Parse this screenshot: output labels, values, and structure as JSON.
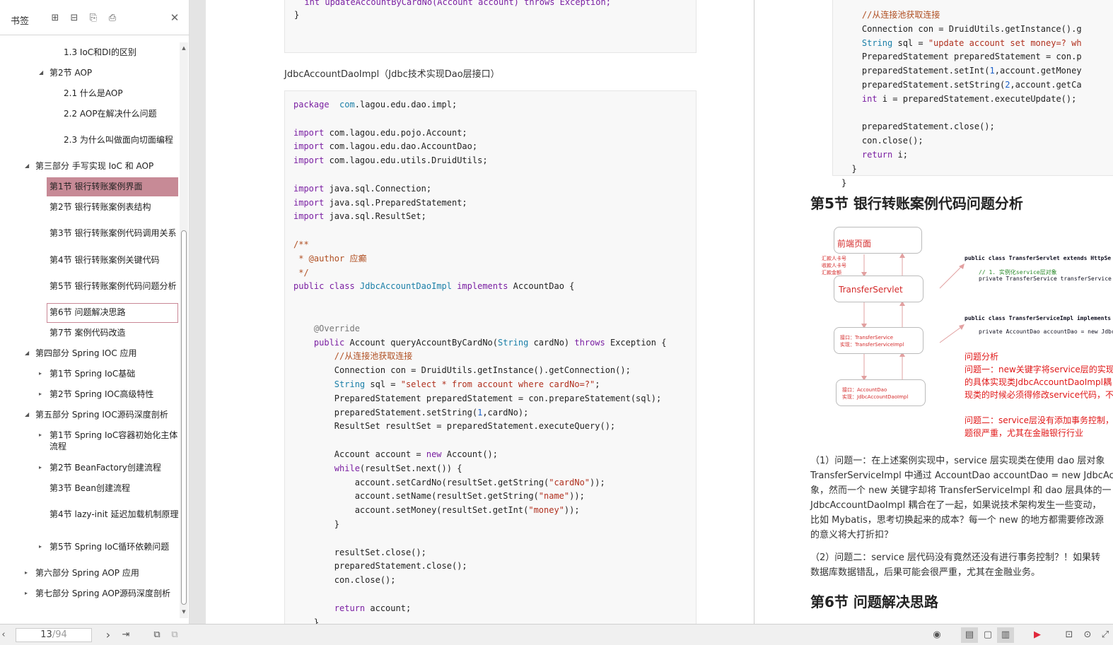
{
  "sidebar": {
    "title": "书签",
    "tools": [
      "expand-all-icon",
      "collapse-all-icon",
      "add-bookmark-icon",
      "bookmark-icon"
    ],
    "items": [
      {
        "label": "1.3 IoC和DI的区别",
        "level": 2
      },
      {
        "label": "第2节 AOP",
        "level": 1,
        "expanded": true
      },
      {
        "label": "2.1 什么是AOP",
        "level": 2
      },
      {
        "label": "2.2 AOP在解决什么问题",
        "level": 2
      },
      {
        "label": "2.3 为什么叫做面向切面编程",
        "level": 2
      },
      {
        "label": "第三部分 手写实现 IoC 和 AOP",
        "level": 0,
        "expanded": true
      },
      {
        "label": "第1节 银行转账案例界面",
        "level": 1,
        "active": true
      },
      {
        "label": "第2节 银行转账案例表结构",
        "level": 1
      },
      {
        "label": "第3节 银行转账案例代码调用关系",
        "level": 1
      },
      {
        "label": "第4节 银行转账案例关键代码",
        "level": 1
      },
      {
        "label": "第5节 银行转账案例代码问题分析",
        "level": 1
      },
      {
        "label": "第6节 问题解决思路",
        "level": 1,
        "outlined": true
      },
      {
        "label": "第7节 案例代码改造",
        "level": 1
      },
      {
        "label": "第四部分 Spring IOC 应用",
        "level": 0,
        "expanded": true
      },
      {
        "label": "第1节 Spring IoC基础",
        "level": 1,
        "collapsed": true
      },
      {
        "label": "第2节 Spring IOC高级特性",
        "level": 1,
        "collapsed": true
      },
      {
        "label": "第五部分 Spring IOC源码深度剖析",
        "level": 0,
        "expanded": true
      },
      {
        "label": "第1节 Spring IoC容器初始化主体流程",
        "level": 1,
        "collapsed": true
      },
      {
        "label": "第2节 BeanFactory创建流程",
        "level": 1,
        "collapsed": true
      },
      {
        "label": "第3节 Bean创建流程",
        "level": 1
      },
      {
        "label": "第4节 lazy-init 延迟加载机制原理",
        "level": 1
      },
      {
        "label": "第5节 Spring IoC循环依赖问题",
        "level": 1,
        "collapsed": true
      },
      {
        "label": "第六部分 Spring AOP 应用",
        "level": 0,
        "collapsed": true
      },
      {
        "label": "第七部分 Spring AOP源码深度剖析",
        "level": 0,
        "collapsed": true
      }
    ]
  },
  "page1": {
    "top_code": [
      "int updateAccountByCardNo(Account account) throws Exception;",
      "}"
    ],
    "caption": "JdbcAccountDaoImpl（Jdbc技术实现Dao层接口）",
    "code": [
      [
        [
          "kw",
          "package"
        ],
        [
          "",
          "  "
        ],
        [
          "tp",
          "com"
        ],
        [
          "",
          ".lagou.edu.dao.impl;"
        ]
      ],
      [],
      [
        [
          "kw",
          "import"
        ],
        [
          "",
          " com.lagou.edu.pojo.Account;"
        ]
      ],
      [
        [
          "kw",
          "import"
        ],
        [
          "",
          " com.lagou.edu.dao.AccountDao;"
        ]
      ],
      [
        [
          "kw",
          "import"
        ],
        [
          "",
          " com.lagou.edu.utils.DruidUtils;"
        ]
      ],
      [],
      [
        [
          "kw",
          "import"
        ],
        [
          "",
          " java.sql.Connection;"
        ]
      ],
      [
        [
          "kw",
          "import"
        ],
        [
          "",
          " java.sql.PreparedStatement;"
        ]
      ],
      [
        [
          "kw",
          "import"
        ],
        [
          "",
          " java.sql.ResultSet;"
        ]
      ],
      [],
      [
        [
          "cm",
          "/**"
        ]
      ],
      [
        [
          "cm",
          " * @author 应癫"
        ]
      ],
      [
        [
          "cm",
          " */"
        ]
      ],
      [
        [
          "kw",
          "public class "
        ],
        [
          "tp",
          "JdbcAccountDaoImpl"
        ],
        [
          "kw",
          " implements"
        ],
        [
          "",
          " AccountDao {"
        ]
      ],
      [],
      [],
      [
        [
          "an",
          "    @Override"
        ]
      ],
      [
        [
          "kw",
          "    public"
        ],
        [
          "",
          " Account queryAccountByCardNo("
        ],
        [
          "tp",
          "String"
        ],
        [
          "",
          " cardNo) "
        ],
        [
          "kw",
          "throws"
        ],
        [
          "",
          " Exception {"
        ]
      ],
      [
        [
          "cm",
          "        //从连接池获取连接"
        ]
      ],
      [
        [
          "",
          "        Connection con = DruidUtils.getInstance().getConnection();"
        ]
      ],
      [
        [
          "tp",
          "        String"
        ],
        [
          "",
          " sql = "
        ],
        [
          "st",
          "\"select * from account where cardNo=?\""
        ],
        [
          ";"
        ]
      ],
      [
        [
          "",
          "        PreparedStatement preparedStatement = con.prepareStatement(sql);"
        ]
      ],
      [
        [
          "",
          "        preparedStatement.setString("
        ],
        [
          "num",
          "1"
        ],
        [
          "",
          ",cardNo);"
        ]
      ],
      [
        [
          "",
          "        ResultSet resultSet = preparedStatement.executeQuery();"
        ]
      ],
      [],
      [
        [
          "",
          "        Account account = "
        ],
        [
          "kw",
          "new"
        ],
        [
          "",
          " Account();"
        ]
      ],
      [
        [
          "kw",
          "        while"
        ],
        [
          "",
          "(resultSet.next()) {"
        ]
      ],
      [
        [
          "",
          "            account.setCardNo(resultSet.getString("
        ],
        [
          "st",
          "\"cardNo\""
        ],
        [
          "",
          "));"
        ]
      ],
      [
        [
          "",
          "            account.setName(resultSet.getString("
        ],
        [
          "st",
          "\"name\""
        ],
        [
          "",
          "));"
        ]
      ],
      [
        [
          "",
          "            account.setMoney(resultSet.getInt("
        ],
        [
          "st",
          "\"money\""
        ],
        [
          "",
          "));"
        ]
      ],
      [
        [
          "",
          "        }"
        ]
      ],
      [],
      [
        [
          "",
          "        resultSet.close();"
        ]
      ],
      [
        [
          "",
          "        preparedStatement.close();"
        ]
      ],
      [
        [
          "",
          "        con.close();"
        ]
      ],
      [],
      [
        [
          "kw",
          "        return"
        ],
        [
          "",
          " account;"
        ]
      ],
      [
        [
          "",
          "    }"
        ]
      ]
    ]
  },
  "page2": {
    "code": [
      [
        [
          "cm",
          "    //从连接池获取连接"
        ]
      ],
      [
        [
          "",
          "    Connection con = DruidUtils.getInstance().g"
        ]
      ],
      [
        [
          "tp",
          "    String"
        ],
        [
          "",
          " sql = "
        ],
        [
          "st",
          "\"update account set money=? wh"
        ]
      ],
      [
        [
          "",
          "    PreparedStatement preparedStatement = con.p"
        ]
      ],
      [
        [
          "",
          "    preparedStatement.setInt("
        ],
        [
          "num",
          "1"
        ],
        [
          "",
          ",account.getMoney"
        ]
      ],
      [
        [
          "",
          "    preparedStatement.setString("
        ],
        [
          "num",
          "2"
        ],
        [
          "",
          ",account.getCa"
        ]
      ],
      [
        [
          "kw",
          "    int"
        ],
        [
          "",
          " i = preparedStatement.executeUpdate();"
        ]
      ],
      [],
      [
        [
          "",
          "    preparedStatement.close();"
        ]
      ],
      [
        [
          "",
          "    con.close();"
        ]
      ],
      [
        [
          "kw",
          "    return"
        ],
        [
          "",
          " i;"
        ]
      ],
      [
        [
          "",
          "  }"
        ]
      ],
      [
        [
          "",
          "}"
        ]
      ]
    ],
    "heading5": "第5节 银行转账案例代码问题分析",
    "diagram": {
      "box1": "前端页面",
      "box2": "TransferServlet",
      "box3": [
        "接口：TransferService",
        "实现：TransferServiceImpl"
      ],
      "box4": [
        "接口：AccountDao",
        "实现：JdbcAccountDaoImpl"
      ],
      "side_labels": [
        "汇款人卡号",
        "收款人卡号",
        "汇款金额"
      ],
      "code1": [
        "public class TransferServlet extends HttpSe",
        "// 1. 实例化service层对象",
        "private TransferService transferService"
      ],
      "code2": [
        "public class TransferServiceImpl implements",
        "private AccountDao accountDao = new Jdbc"
      ],
      "analysis": [
        "问题分析",
        "问题一：new关键字将service层的实现",
        "的具体实现类JdbcAccountDaoImpl耦",
        "现类的时候必须得修改service代码，不",
        "",
        "问题二：service层没有添加事务控制，",
        "题很严重，尤其在金融银行行业"
      ]
    },
    "paragraphs": [
      "（1）问题一：在上述案例实现中，service 层实现类在使用 dao 层对象",
      "TransferServiceImpl 中通过 AccountDao accountDao = new JdbcAcco",
      "象，然而一个 new 关键字却将 TransferServiceImpl 和 dao 层具体的一",
      "JdbcAccountDaoImpl 耦合在了一起，如果说技术架构发生一些变动，",
      "比如 Mybatis，思考切换起来的成本？每一个 new 的地方都需要修改源",
      "的意义将大打折扣？"
    ],
    "paragraph2": [
      "（2）问题二：service 层代码没有竟然还没有进行事务控制？！如果转",
      "数据库数据错乱，后果可能会很严重，尤其在金融业务。"
    ],
    "heading6": "第6节 问题解决思路"
  },
  "bottombar": {
    "page_current": "13",
    "page_total": "/94"
  }
}
